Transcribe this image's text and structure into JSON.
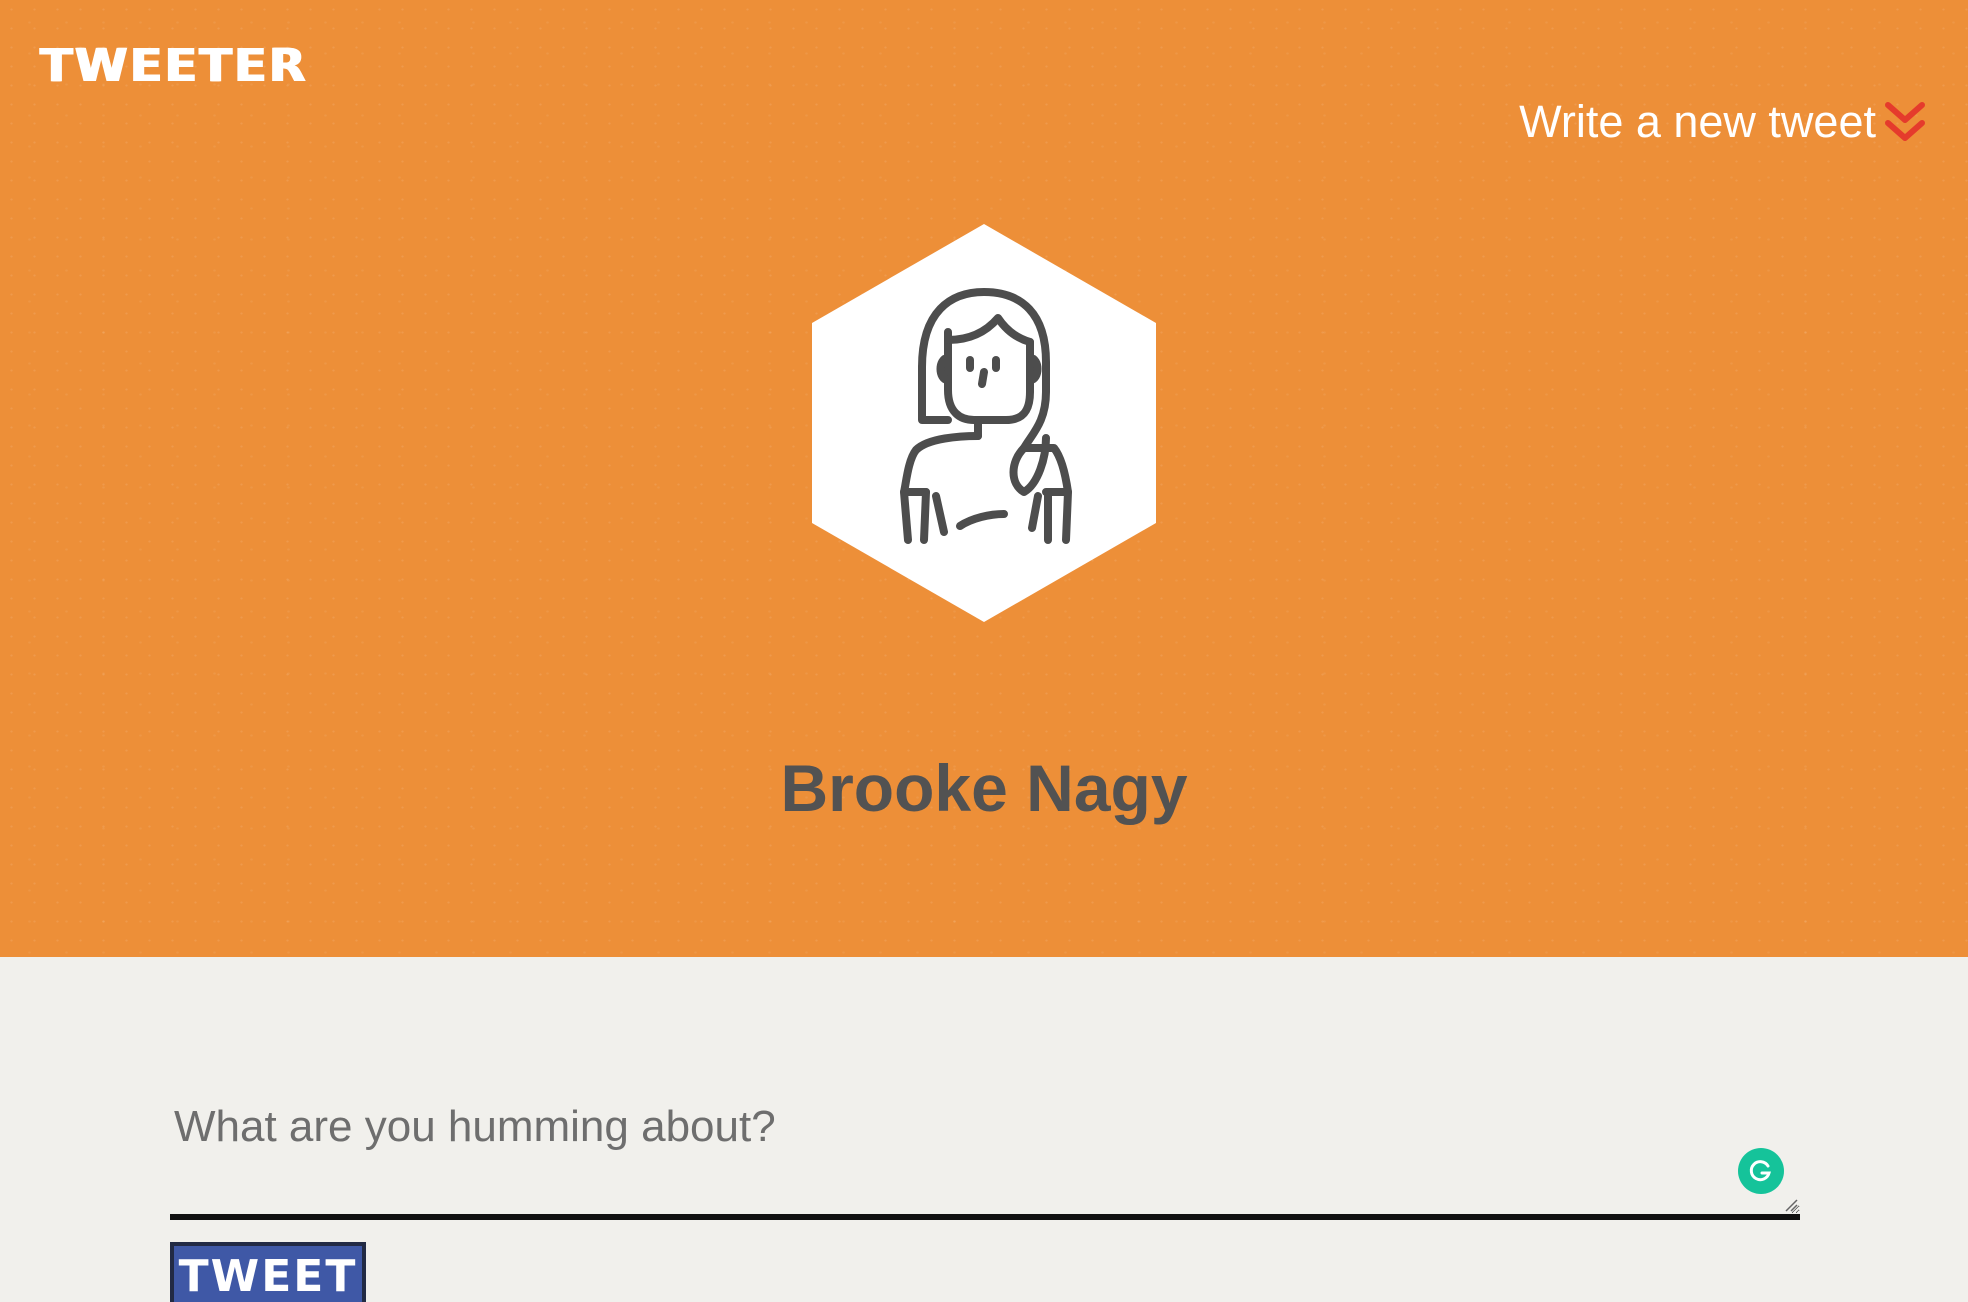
{
  "header": {
    "logo_text": "TWEETER",
    "write_link_label": "Write a new tweet",
    "write_link_icon": "double-chevron-down-icon"
  },
  "profile": {
    "avatar_icon": "user-avatar-icon",
    "name": "Brooke Nagy"
  },
  "composer": {
    "placeholder": "What are you humming about?",
    "value": "",
    "submit_label": "TWEET",
    "grammarly_icon": "grammarly-icon"
  },
  "colors": {
    "hero_background": "#ed8f38",
    "page_background": "#f1f0ec",
    "name_text": "#525252",
    "chevron_accent": "#e53b2c",
    "button_background": "#3f58a6",
    "grammarly_green": "#15c39a"
  }
}
